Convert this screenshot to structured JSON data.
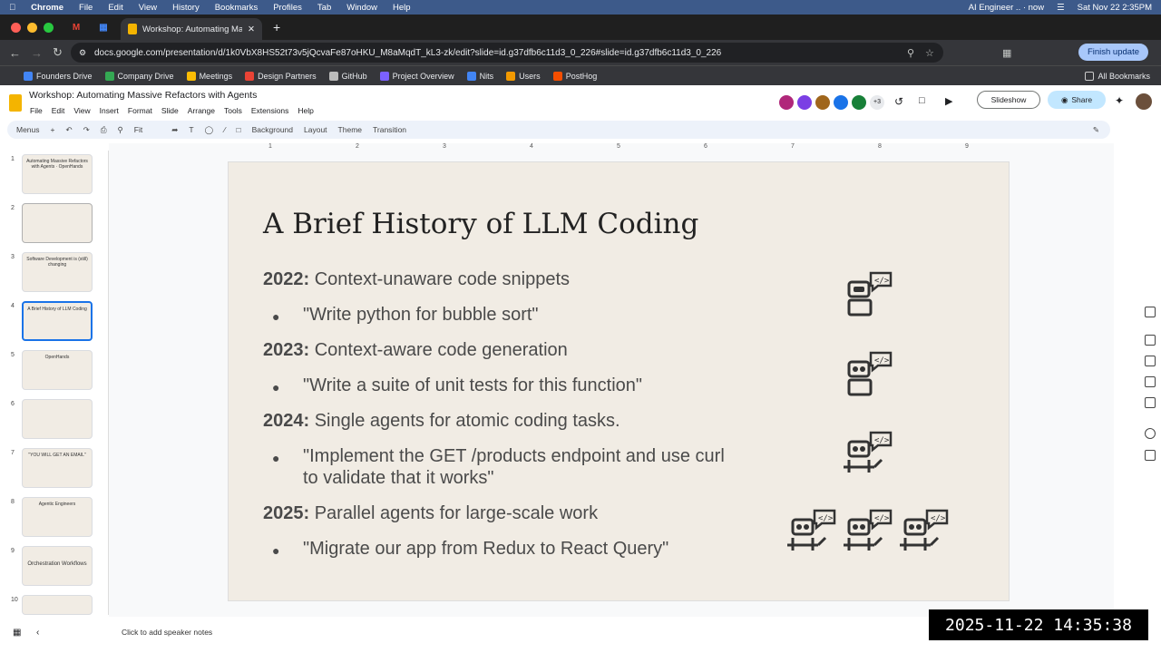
{
  "mac_menu": {
    "app": "Chrome",
    "items": [
      "File",
      "Edit",
      "View",
      "History",
      "Bookmarks",
      "Profiles",
      "Tab",
      "Window",
      "Help"
    ],
    "right": [
      "AI Engineer .. · now",
      "Sat Nov 22  2:35PM"
    ]
  },
  "tab": {
    "title": "Workshop: Automating Massive"
  },
  "address": {
    "url": "docs.google.com/presentation/d/1k0VbX8HS52t73v5jQcvaFe87oHKU_M8aMqdT_kL3-zk/edit?slide=id.g37dfb6c11d3_0_226#slide=id.g37dfb6c11d3_0_226",
    "finish": "Finish update"
  },
  "bookmarks": [
    {
      "label": "Founders Drive",
      "color": "#4285f4"
    },
    {
      "label": "Company Drive",
      "color": "#34a853"
    },
    {
      "label": "Meetings",
      "color": "#fbbc04"
    },
    {
      "label": "Design Partners",
      "color": "#ea4335"
    },
    {
      "label": "GitHub",
      "color": "#bbbbbb"
    },
    {
      "label": "Project Overview",
      "color": "#7b61ff"
    },
    {
      "label": "Nits",
      "color": "#4285f4"
    },
    {
      "label": "Users",
      "color": "#f29900"
    },
    {
      "label": "PostHog",
      "color": "#f54e00"
    }
  ],
  "all_bookmarks": "All Bookmarks",
  "doc": {
    "title": "Workshop: Automating Massive Refactors with Agents",
    "menu": [
      "File",
      "Edit",
      "View",
      "Insert",
      "Format",
      "Slide",
      "Arrange",
      "Tools",
      "Extensions",
      "Help"
    ],
    "more_users": "+3",
    "slideshow": "Slideshow",
    "share": "Share"
  },
  "toolbar": {
    "menus": "Menus",
    "zoom": "Fit",
    "buttons": [
      "Background",
      "Layout",
      "Theme",
      "Transition"
    ]
  },
  "ruler_ticks": [
    "1",
    "2",
    "3",
    "4",
    "5",
    "6",
    "7",
    "8",
    "9"
  ],
  "thumbs": [
    {
      "n": "1",
      "text": "Automating Massive Refactors with Agents · OpenHands"
    },
    {
      "n": "2",
      "text": ""
    },
    {
      "n": "3",
      "text": "Software Development is (still) changing"
    },
    {
      "n": "4",
      "text": "A Brief History of LLM Coding"
    },
    {
      "n": "5",
      "text": "OpenHands"
    },
    {
      "n": "6",
      "text": ""
    },
    {
      "n": "7",
      "text": "\"YOU WILL GET AN EMAIL\""
    },
    {
      "n": "8",
      "text": "Agentic Engineers"
    },
    {
      "n": "9",
      "text": "Orchestration Workflows"
    },
    {
      "n": "10",
      "text": ""
    }
  ],
  "slide": {
    "title": "A Brief History of LLM Coding",
    "rows": [
      {
        "year": "2022:",
        "text": "Context-unaware code snippets",
        "bullet": "\"Write python for bubble sort\""
      },
      {
        "year": "2023:",
        "text": "Context-aware code generation",
        "bullet": "\"Write a suite of unit tests for this function\""
      },
      {
        "year": "2024:",
        "text": "Single agents for atomic coding tasks.",
        "bullet": "\"Implement the GET /products endpoint and use curl to validate that it works\""
      },
      {
        "year": "2025:",
        "text": "Parallel agents for large-scale work",
        "bullet": "\"Migrate our app from Redux to React Query\""
      }
    ]
  },
  "notes": "Click to add speaker notes",
  "timestamp": "2025-11-22 14:35:38"
}
